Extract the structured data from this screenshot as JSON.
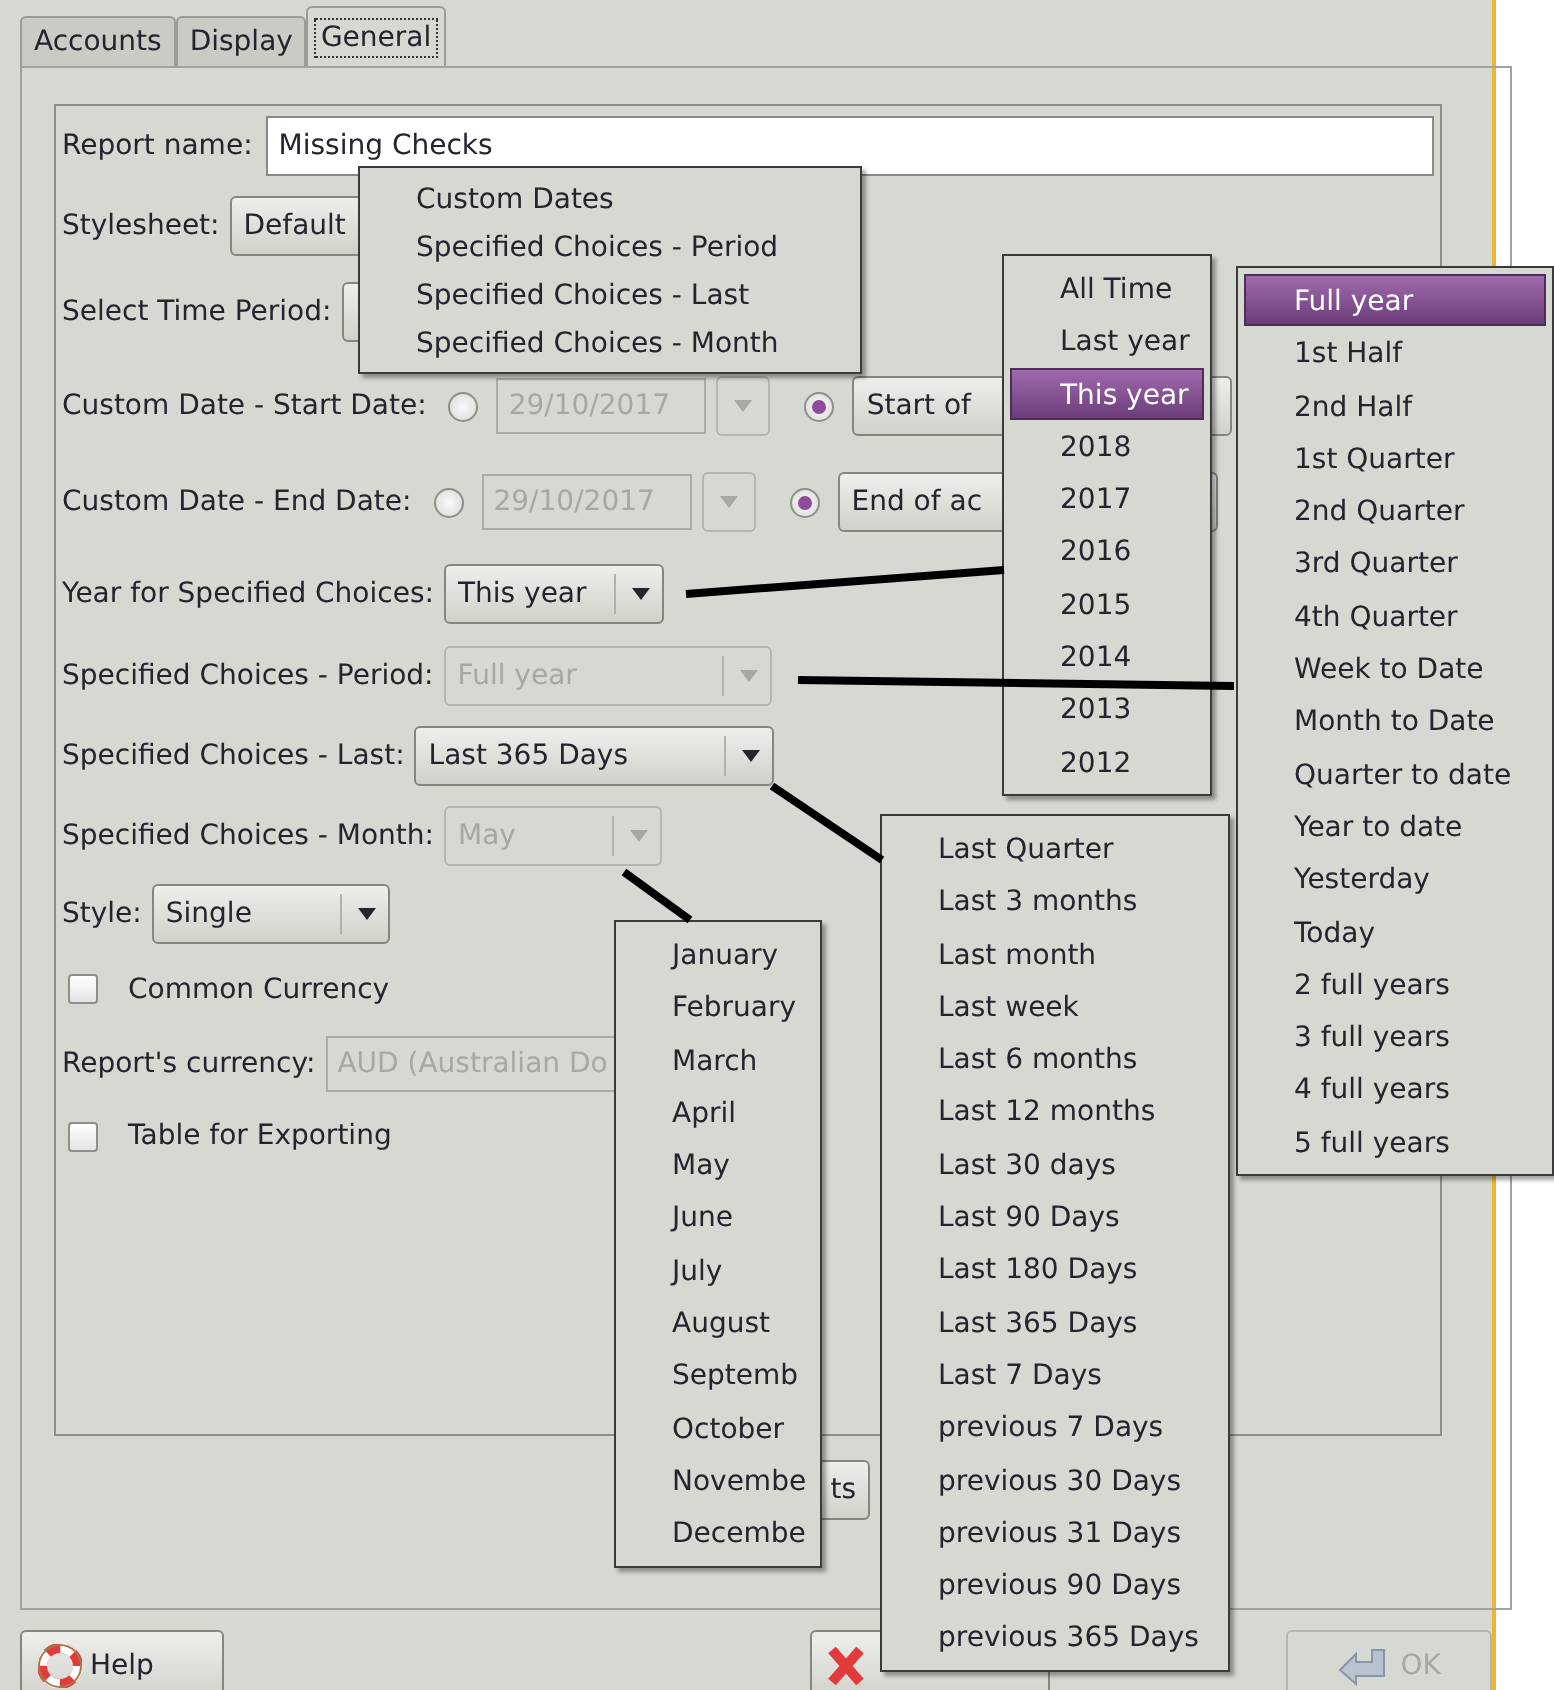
{
  "tabs": [
    {
      "label": "Accounts",
      "selected": false
    },
    {
      "label": "Display",
      "selected": false
    },
    {
      "label": "General",
      "selected": true
    }
  ],
  "form": {
    "rows": [
      {
        "kind": "entry",
        "label": "Report name:",
        "value": "Missing Checks"
      },
      {
        "kind": "combo",
        "label": "Stylesheet:",
        "value": "Default",
        "disabled": false
      },
      {
        "kind": "combo",
        "label": "Select Time Period:",
        "disabled": false
      },
      {
        "kind": "date",
        "label": "Custom Date - Start Date:",
        "date": "29/10/2017",
        "absolute_selected": false,
        "relative_selected": true,
        "relative_value": "Start of"
      },
      {
        "kind": "date",
        "label": "Custom Date - End Date:",
        "date": "29/10/2017",
        "absolute_selected": false,
        "relative_selected": true,
        "relative_value": "End of ac"
      },
      {
        "kind": "combo",
        "label": "Year for Specified Choices:",
        "value": "This year",
        "disabled": false
      },
      {
        "kind": "combo",
        "label": "Specified Choices - Period:",
        "value": "Full year",
        "disabled": true
      },
      {
        "kind": "combo",
        "label": "Specified Choices - Last:",
        "value": "Last 365 Days",
        "disabled": false
      },
      {
        "kind": "combo",
        "label": "Specified Choices - Month:",
        "value": "May",
        "disabled": true
      },
      {
        "kind": "combo",
        "label": "Style:",
        "value": "Single",
        "disabled": false
      },
      {
        "kind": "check",
        "label": "Common Currency",
        "checked": false
      },
      {
        "kind": "currency",
        "label": "Report's currency:",
        "value": "AUD (Australian Do",
        "disabled": true
      },
      {
        "kind": "check",
        "label": "Table for Exporting",
        "checked": false
      }
    ]
  },
  "extra_button": {
    "label": "ts"
  },
  "buttons": [
    {
      "kind": "help",
      "label": "Help",
      "disabled": false
    },
    {
      "kind": "cancel",
      "disabled": false
    },
    {
      "kind": "ok",
      "label": "OK",
      "disabled": true
    }
  ],
  "menus": [
    {
      "items": [
        {
          "label": "Custom Dates",
          "selected": false
        },
        {
          "label": "Specified Choices - Period",
          "selected": false
        },
        {
          "label": "Specified Choices - Last",
          "selected": false
        },
        {
          "label": "Specified Choices - Month",
          "selected": false
        }
      ]
    },
    {
      "items": [
        {
          "label": "All Time",
          "selected": false
        },
        {
          "label": "Last year",
          "selected": false
        },
        {
          "label": "This year",
          "selected": true
        },
        {
          "label": "2018",
          "selected": false
        },
        {
          "label": "2017",
          "selected": false
        },
        {
          "label": "2016",
          "selected": false
        },
        {
          "label": "2015",
          "selected": false
        },
        {
          "label": "2014",
          "selected": false
        },
        {
          "label": "2013",
          "selected": false
        },
        {
          "label": "2012",
          "selected": false
        }
      ]
    },
    {
      "items": [
        {
          "label": "Full year",
          "selected": true
        },
        {
          "label": "1st Half",
          "selected": false
        },
        {
          "label": "2nd Half",
          "selected": false
        },
        {
          "label": "1st Quarter",
          "selected": false
        },
        {
          "label": "2nd Quarter",
          "selected": false
        },
        {
          "label": "3rd Quarter",
          "selected": false
        },
        {
          "label": "4th Quarter",
          "selected": false
        },
        {
          "label": "Week to Date",
          "selected": false
        },
        {
          "label": "Month to Date",
          "selected": false
        },
        {
          "label": "Quarter to date",
          "selected": false
        },
        {
          "label": "Year to date",
          "selected": false
        },
        {
          "label": "Yesterday",
          "selected": false
        },
        {
          "label": "Today",
          "selected": false
        },
        {
          "label": "2 full years",
          "selected": false
        },
        {
          "label": "3 full years",
          "selected": false
        },
        {
          "label": "4 full years",
          "selected": false
        },
        {
          "label": "5 full years",
          "selected": false
        }
      ]
    },
    {
      "items": [
        {
          "label": "January",
          "selected": false
        },
        {
          "label": "February",
          "selected": false
        },
        {
          "label": "March",
          "selected": false
        },
        {
          "label": "April",
          "selected": false
        },
        {
          "label": "May",
          "selected": false
        },
        {
          "label": "June",
          "selected": false
        },
        {
          "label": "July",
          "selected": false
        },
        {
          "label": "August",
          "selected": false
        },
        {
          "label": "Septemb",
          "selected": false
        },
        {
          "label": "October",
          "selected": false
        },
        {
          "label": "Novembe",
          "selected": false
        },
        {
          "label": "Decembe",
          "selected": false
        }
      ]
    },
    {
      "items": [
        {
          "label": "Last Quarter",
          "selected": false
        },
        {
          "label": "Last 3 months",
          "selected": false
        },
        {
          "label": "Last month",
          "selected": false
        },
        {
          "label": "Last week",
          "selected": false
        },
        {
          "label": "Last 6 months",
          "selected": false
        },
        {
          "label": "Last 12 months",
          "selected": false
        },
        {
          "label": "Last 30 days",
          "selected": false
        },
        {
          "label": "Last 90 Days",
          "selected": false
        },
        {
          "label": "Last 180 Days",
          "selected": false
        },
        {
          "label": "Last 365 Days",
          "selected": false
        },
        {
          "label": "Last 7 Days",
          "selected": false
        },
        {
          "label": "previous 7 Days",
          "selected": false
        },
        {
          "label": "previous 30 Days",
          "selected": false
        },
        {
          "label": "previous 31 Days",
          "selected": false
        },
        {
          "label": "previous 90 Days",
          "selected": false
        },
        {
          "label": "previous 365 Days",
          "selected": false
        }
      ]
    }
  ]
}
